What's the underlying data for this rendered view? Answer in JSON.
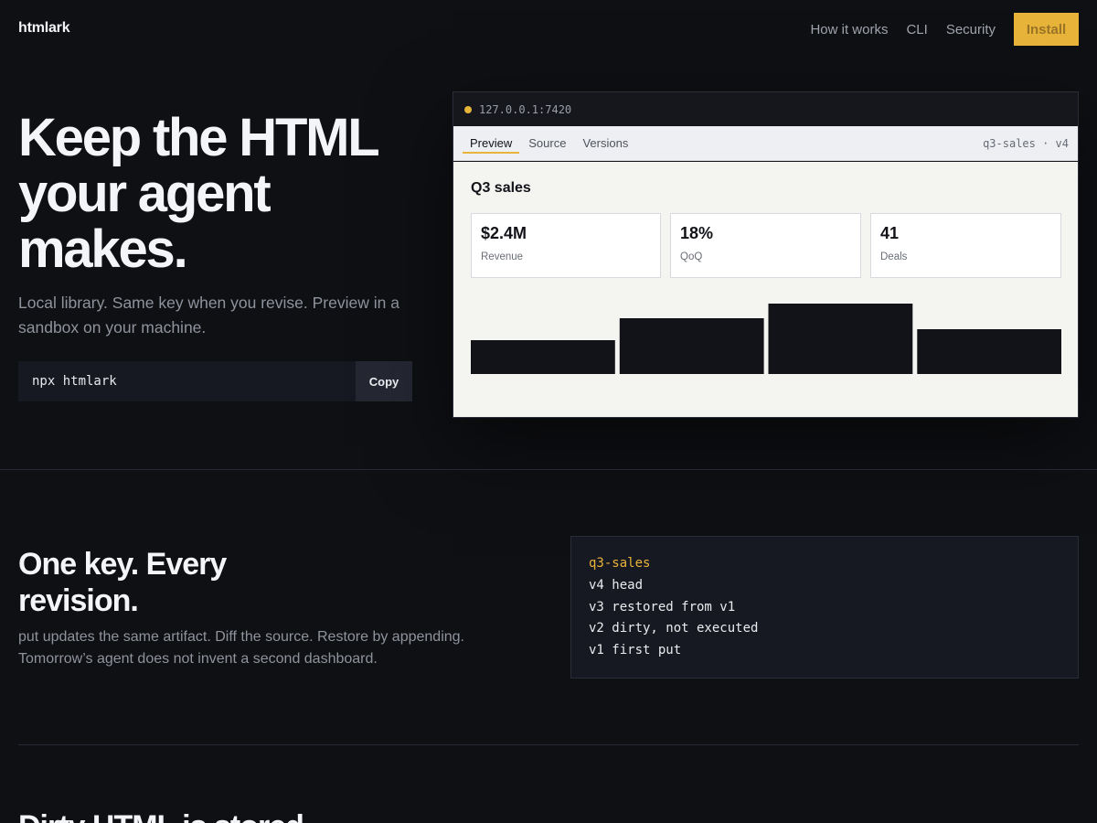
{
  "nav": {
    "brand": "htmlark",
    "links": [
      "How it works",
      "CLI",
      "Security"
    ],
    "install_label": "Install"
  },
  "hero": {
    "title": "Keep the HTML your agent makes.",
    "subtitle": "Local library. Same key when you revise. Preview in a sandbox on your machine.",
    "command": "npx htmlark",
    "copy_label": "Copy"
  },
  "preview": {
    "url": "127.0.0.1:7420",
    "tabs": [
      "Preview",
      "Source",
      "Versions"
    ],
    "active_tab": "Preview",
    "artifact": "q3-sales · v4",
    "dashboard": {
      "title": "Q3 sales",
      "stats": [
        {
          "value": "$2.4M",
          "label": "Revenue"
        },
        {
          "value": "18%",
          "label": "QoQ"
        },
        {
          "value": "41",
          "label": "Deals"
        }
      ],
      "bar_levels": [
        0.48,
        0.79,
        1.0,
        0.64
      ]
    }
  },
  "revisions": {
    "title": "One key. Every revision.",
    "text": "put updates the same artifact. Diff the source. Restore by appending. Tomorrow’s agent does not invent a second dashboard.",
    "code": {
      "key": "q3-sales",
      "lines": [
        "v4 head",
        "v3 restored from v1",
        "v2 dirty, not executed",
        "v1 first put"
      ]
    }
  },
  "next_section": {
    "title": "Dirty HTML is stored"
  },
  "colors": {
    "background": "#0f1014",
    "accent": "#e9b43a",
    "panel": "#171922",
    "muted_text": "#8f939c"
  }
}
